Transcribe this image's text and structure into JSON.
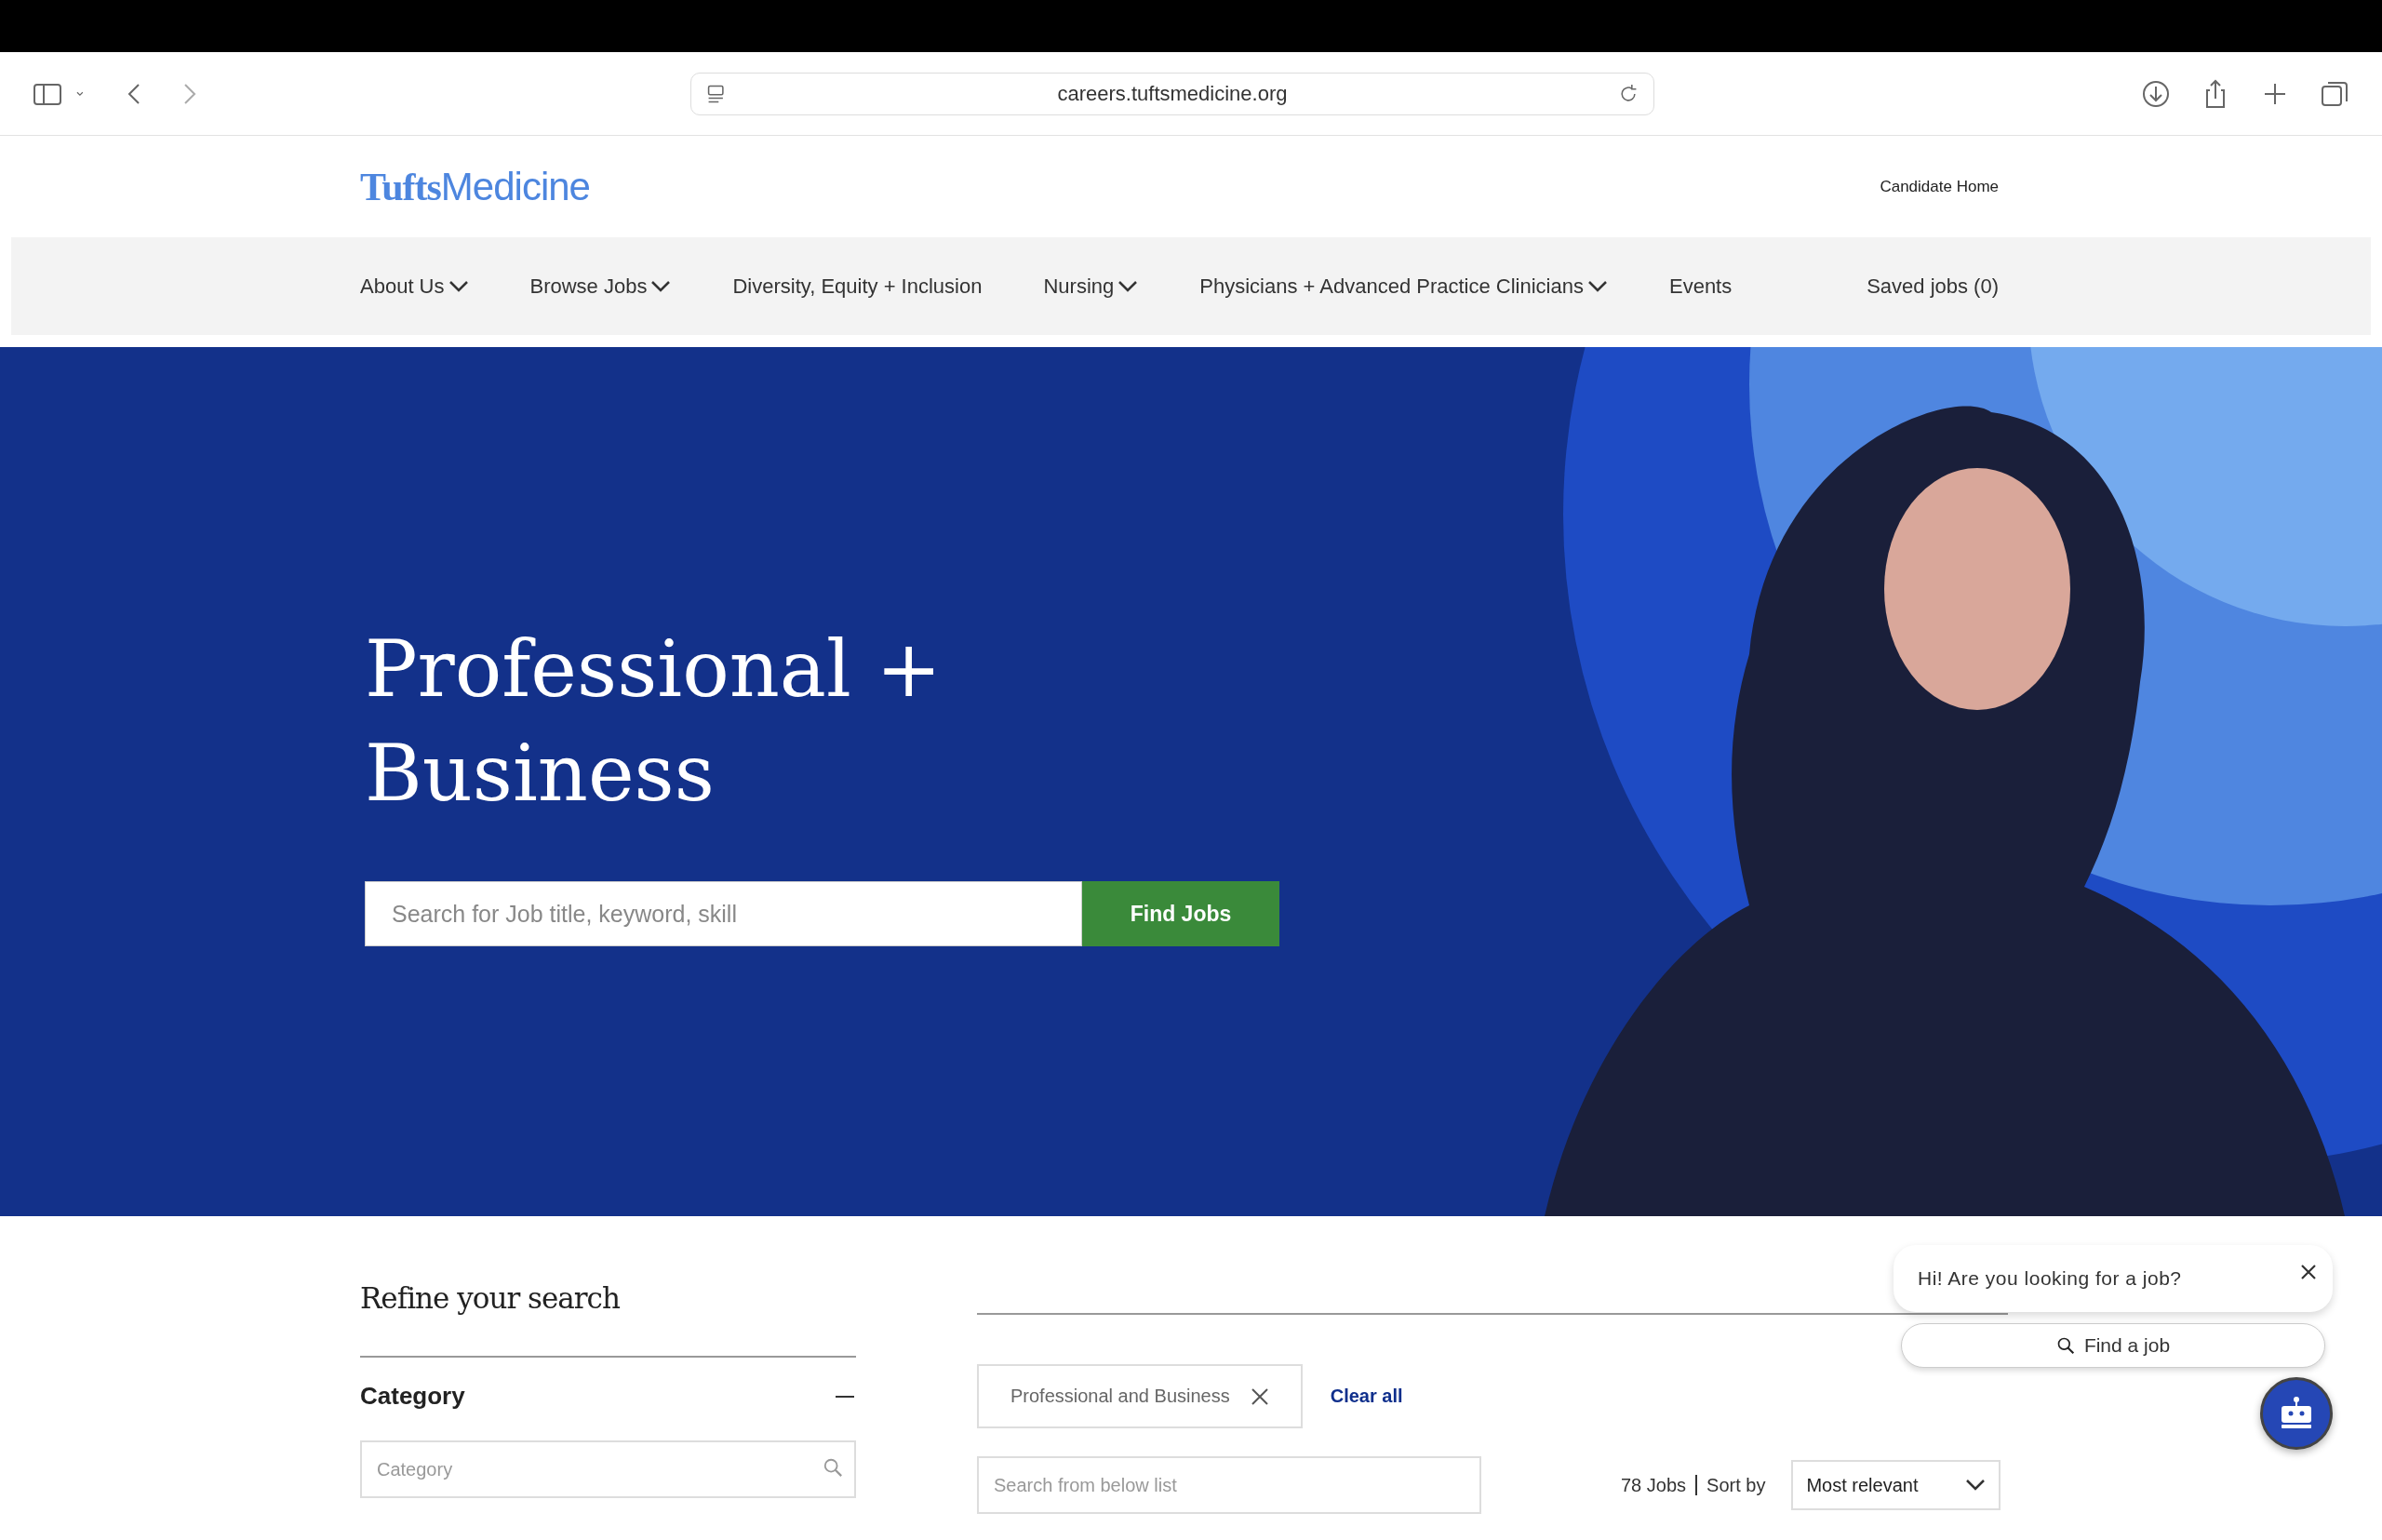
{
  "browser": {
    "url": "careers.tuftsmedicine.org"
  },
  "header": {
    "logo_bold": "Tufts",
    "logo_light": "Medicine",
    "candidate_home": "Candidate Home"
  },
  "nav": {
    "items": [
      {
        "label": "About Us",
        "has_menu": true
      },
      {
        "label": "Browse Jobs",
        "has_menu": true
      },
      {
        "label": "Diversity, Equity + Inclusion",
        "has_menu": false
      },
      {
        "label": "Nursing",
        "has_menu": true
      },
      {
        "label": "Physicians + Advanced Practice Clinicians",
        "has_menu": true
      },
      {
        "label": "Events",
        "has_menu": false
      }
    ],
    "saved_jobs": "Saved jobs (0)"
  },
  "hero": {
    "title_lines": [
      "Professional +",
      "Business"
    ],
    "search": {
      "placeholder": "Search for Job title, keyword, skill"
    },
    "button": "Find Jobs"
  },
  "refine": {
    "title": "Refine your search",
    "category": {
      "label": "Category",
      "expanded": true,
      "search": {
        "placeholder": "Category"
      }
    }
  },
  "results": {
    "filters": [
      {
        "label": "Professional and Business"
      }
    ],
    "clear_all": "Clear all",
    "search": {
      "placeholder": "Search from below list"
    },
    "count": "78 Jobs",
    "sort_label": "Sort by",
    "sort_value": "Most relevant"
  },
  "chat": {
    "greeting": "Hi! Are you looking for a job?",
    "button": "Find a job"
  }
}
